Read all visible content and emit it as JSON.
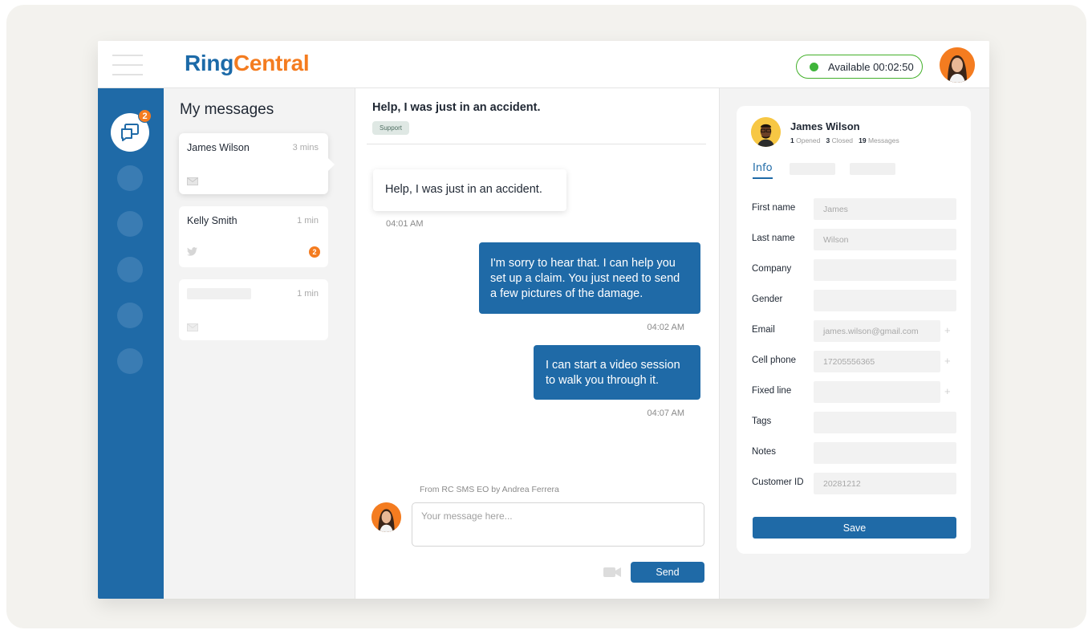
{
  "app": {
    "logo_part1": "Ring",
    "logo_part2": "Central",
    "status_label": "Available 00:02:50",
    "brand_blue": "#1f6aa7",
    "brand_orange": "#f47c20",
    "status_green": "#3fb43a"
  },
  "rail": {
    "messages_badge": "2"
  },
  "messages": {
    "title": "My messages",
    "items": [
      {
        "name": "James Wilson",
        "time": "3 mins",
        "channel": "envelope-icon"
      },
      {
        "name": "Kelly Smith",
        "time": "1 min",
        "channel": "twitter-icon",
        "unread": "2"
      },
      {
        "name": "",
        "time": "1 min",
        "channel": "envelope-icon"
      }
    ]
  },
  "chat": {
    "subject": "Help, I was just in an accident.",
    "tag": "Support",
    "messages": [
      {
        "direction": "in",
        "text": "Help, I was just in an accident.",
        "time": "04:01 AM"
      },
      {
        "direction": "out",
        "text": "I'm sorry to hear that. I can help you set up a claim. You just need to send a few pictures of the damage.",
        "time": "04:02 AM"
      },
      {
        "direction": "out",
        "text": "I can start a video session to walk you through it.",
        "time": "04:07 AM"
      }
    ],
    "from_line": "From RC SMS EO by Andrea Ferrera",
    "composer_placeholder": "Your message here...",
    "send_label": "Send"
  },
  "contact": {
    "name": "James Wilson",
    "opened_count": "1",
    "opened_label": "Opened",
    "closed_count": "3",
    "closed_label": "Closed",
    "messages_count": "19",
    "messages_label": "Messages",
    "active_tab": "Info",
    "fields": [
      {
        "label": "First name",
        "value": "James"
      },
      {
        "label": "Last name",
        "value": "Wilson"
      },
      {
        "label": "Company",
        "value": ""
      },
      {
        "label": "Gender",
        "value": ""
      },
      {
        "label": "Email",
        "value": "james.wilson@gmail.com",
        "plus": "+"
      },
      {
        "label": "Cell phone",
        "value": "17205556365",
        "plus": "+"
      },
      {
        "label": "Fixed line",
        "value": "",
        "plus": "+"
      },
      {
        "label": "Tags",
        "value": ""
      },
      {
        "label": "Notes",
        "value": ""
      },
      {
        "label": "Customer ID",
        "value": "20281212"
      }
    ],
    "save_label": "Save"
  }
}
